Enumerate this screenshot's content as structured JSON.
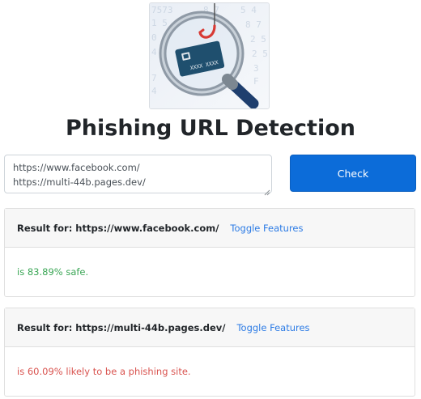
{
  "page": {
    "title": "Phishing URL Detection"
  },
  "form": {
    "urls_value": "https://www.facebook.com/\nhttps://multi-44b.pages.dev/",
    "check_label": "Check"
  },
  "results": [
    {
      "label": "Result for: https://www.facebook.com/",
      "toggle_label": "Toggle Features",
      "verdict": "is 83.89% safe.",
      "status": "safe"
    },
    {
      "label": "Result for: https://multi-44b.pages.dev/",
      "toggle_label": "Toggle Features",
      "verdict": "is 60.09% likely to be a phishing site.",
      "status": "phishing"
    }
  ],
  "logo": {
    "icon": "magnifier-phishing-hook-card-icon",
    "card_text": "XXXX XXXX"
  },
  "colors": {
    "primary": "#0c6cd9",
    "safe": "#3aa655",
    "danger": "#d9534f",
    "link": "#2c7be5"
  }
}
